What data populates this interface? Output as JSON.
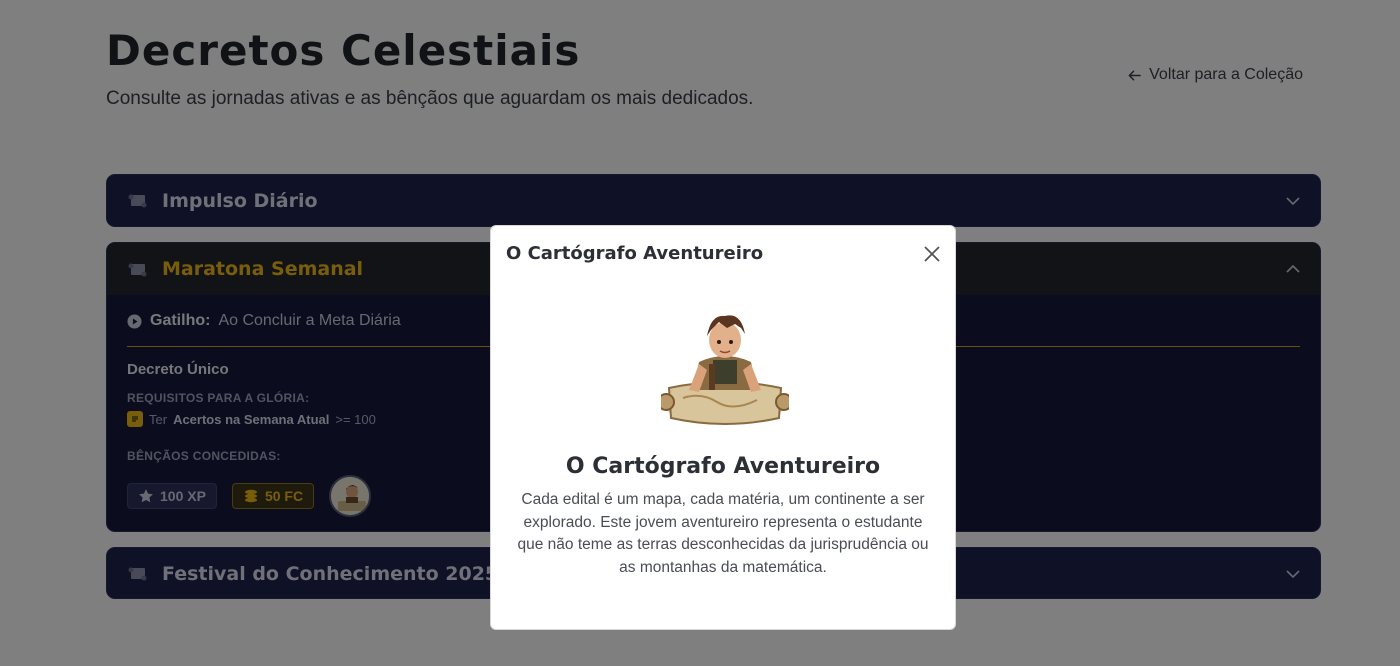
{
  "page": {
    "title": "Decretos Celestiais",
    "subtitle": "Consulte as jornadas ativas e as bênçãos que aguardam os mais dedicados.",
    "back_link": "Voltar para a Coleção"
  },
  "accordions": [
    {
      "title": "Impulso Diário",
      "expanded": false
    },
    {
      "title": "Maratona Semanal",
      "expanded": true,
      "trigger_label": "Gatilho:",
      "trigger_value": "Ao Concluir a Meta Diária",
      "section_title": "Decreto Único",
      "requirements_label": "REQUISITOS PARA A GLÓRIA:",
      "requirement": {
        "prefix": "Ter",
        "metric": "Acertos na Semana Atual",
        "condition": ">= 100"
      },
      "blessings_label": "BÊNÇÃOS CONCEDIDAS:",
      "rewards": {
        "xp": "100 XP",
        "fc": "50 FC"
      }
    },
    {
      "title": "Festival do Conhecimento 2025",
      "expanded": false
    }
  ],
  "modal": {
    "header": "O Cartógrafo Aventureiro",
    "name": "O Cartógrafo Aventureiro",
    "description": "Cada edital é um mapa, cada matéria, um continente a ser explorado. Este jovem aventureiro representa o estudante que não teme as terras desconhecidas da jurisprudência ou as montanhas da matemática."
  },
  "colors": {
    "accent_gold": "#e7b416",
    "accordion_bg": "#1e2249",
    "overlay": "rgba(0,0,0,0.48)"
  }
}
